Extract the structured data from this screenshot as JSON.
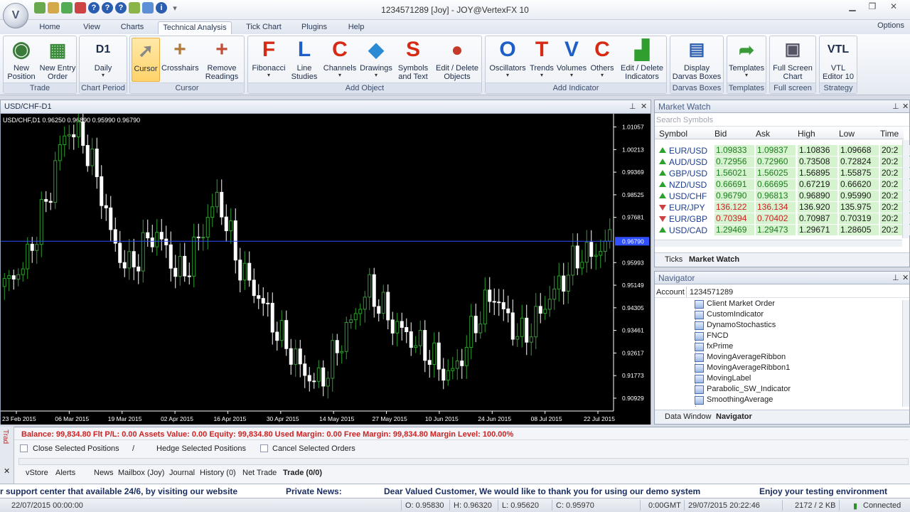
{
  "window": {
    "title": "1234571289 [Joy] - JOY@VertexFX 10",
    "logo": "V",
    "min_icon": "minimize-icon",
    "max_icon": "maximize-icon",
    "close_icon": "close-icon"
  },
  "ribbon_tabs": [
    "Home",
    "View",
    "Charts",
    "Technical Analysis",
    "Tick Chart",
    "Plugins",
    "Help"
  ],
  "options_label": "Options",
  "ribbon": {
    "trade": {
      "label": "Trade",
      "buttons": [
        "New\nPosition",
        "New Entry\nOrder"
      ]
    },
    "chart_period": {
      "label": "Chart Period",
      "buttons": [
        "Daily"
      ],
      "icon_text": "D1"
    },
    "cursor": {
      "label": "Cursor",
      "buttons": [
        "Cursor",
        "Crosshairs",
        "Remove\nReadings"
      ]
    },
    "add_object": {
      "label": "Add Object",
      "buttons": [
        "Fibonacci",
        "Line\nStudies",
        "Channels",
        "Drawings",
        "Symbols\nand Text",
        "Edit / Delete\nObjects"
      ],
      "icon_letters": [
        "F",
        "L",
        "C",
        "",
        "S",
        ""
      ]
    },
    "add_indicator": {
      "label": "Add Indicator",
      "buttons": [
        "Oscillators",
        "Trends",
        "Volumes",
        "Others",
        "Edit / Delete\nIndicators"
      ],
      "icon_letters": [
        "O",
        "T",
        "V",
        "C",
        ""
      ]
    },
    "darvas": {
      "label": "Darvas Boxes",
      "buttons": [
        "Display\nDarvas Boxes"
      ]
    },
    "templates": {
      "label": "Templates",
      "buttons": [
        "Templates"
      ]
    },
    "full_screen": {
      "label": "Full screen",
      "buttons": [
        "Full Screen\nChart"
      ]
    },
    "strategy": {
      "label": "Strategy",
      "buttons": [
        "VTL\nEditor 10"
      ],
      "icon_text": "VTL"
    }
  },
  "chart": {
    "window_title": "USD/CHF-D1",
    "ohlc_header": "USD/CHF,D1  0.96250  0.96890  0.95990  0.96790",
    "current_price_label": "0.96790",
    "price_axis": [
      "1.01057",
      "1.00213",
      "0.99369",
      "0.98525",
      "0.97681",
      "0.96790",
      "0.95993",
      "0.95149",
      "0.94305",
      "0.93461",
      "0.92617",
      "0.91773",
      "0.90929"
    ],
    "date_axis": [
      "23 Feb 2015",
      "06 Mar 2015",
      "19 Mar 2015",
      "02 Apr 2015",
      "16 Apr 2015",
      "30 Apr 2015",
      "14 May 2015",
      "27 May 2015",
      "10 Jun 2015",
      "24 Jun 2015",
      "08 Jul 2015",
      "22 Jul 2015"
    ],
    "colors": {
      "up": "#2f9e2f",
      "down": "#ffffff",
      "background": "#000000",
      "price_line": "#3050ff"
    }
  },
  "market_watch": {
    "title": "Market Watch",
    "search_placeholder": "Search Symbols",
    "columns": [
      "Symbol",
      "Bid",
      "Ask",
      "High",
      "Low",
      "Time"
    ],
    "rows": [
      {
        "dir": "up",
        "symbol": "EUR/USD",
        "bid": "1.09833",
        "ask": "1.09837",
        "high": "1.10836",
        "low": "1.09668",
        "time": "20:2"
      },
      {
        "dir": "up",
        "symbol": "AUD/USD",
        "bid": "0.72956",
        "ask": "0.72960",
        "high": "0.73508",
        "low": "0.72824",
        "time": "20:2"
      },
      {
        "dir": "up",
        "symbol": "GBP/USD",
        "bid": "1.56021",
        "ask": "1.56025",
        "high": "1.56895",
        "low": "1.55875",
        "time": "20:2"
      },
      {
        "dir": "up",
        "symbol": "NZD/USD",
        "bid": "0.66691",
        "ask": "0.66695",
        "high": "0.67219",
        "low": "0.66620",
        "time": "20:2"
      },
      {
        "dir": "up",
        "symbol": "USD/CHF",
        "bid": "0.96790",
        "ask": "0.96813",
        "high": "0.96890",
        "low": "0.95990",
        "time": "20:2"
      },
      {
        "dir": "down",
        "symbol": "EUR/JPY",
        "bid": "136.122",
        "ask": "136.134",
        "high": "136.920",
        "low": "135.975",
        "time": "20:2"
      },
      {
        "dir": "down",
        "symbol": "EUR/GBP",
        "bid": "0.70394",
        "ask": "0.70402",
        "high": "0.70987",
        "low": "0.70319",
        "time": "20:2"
      },
      {
        "dir": "up",
        "symbol": "USD/CAD",
        "bid": "1.29469",
        "ask": "1.29473",
        "high": "1.29671",
        "low": "1.28605",
        "time": "20:2"
      }
    ],
    "tabs": [
      "Ticks",
      "Market Watch"
    ]
  },
  "navigator": {
    "title": "Navigator",
    "account_label": "Account",
    "account_value": "1234571289",
    "items": [
      "Client Market Order",
      "CustomIndicator",
      "DynamoStochastics",
      "FNCD",
      "fxPrime",
      "MovingAverageRibbon",
      "MovingAverageRibbon1",
      "MovingLabel",
      "Parabolic_SW_Indicator",
      "SmoothingAverage"
    ],
    "tabs": [
      "Data Window",
      "Navigator"
    ]
  },
  "terminal": {
    "side_label": "Trad",
    "balance_line": "Balance: 99,834.80  Flt P/L: 0.00  Assets Value: 0.00  Equity: 99,834.80  Used Margin: 0.00  Free Margin: 99,834.80  Margin Level: 100.00%",
    "close_selected": "Close Selected Positions",
    "separator": "/",
    "hedge_selected": "Hedge Selected Positions",
    "cancel_selected": "Cancel Selected Orders",
    "tabs": [
      "vStore",
      "Alerts",
      "News",
      "Mailbox (Joy)",
      "Journal",
      "History (0)",
      "Net Trade",
      "Trade (0/0)"
    ]
  },
  "ticker": {
    "items": [
      "r support center that available 24/6, by visiting our website",
      "Private News:",
      "Dear Valued Customer, We would like to thank you for using our demo system",
      "Enjoy your testing environment"
    ]
  },
  "status": {
    "datetime": "22/07/2015 00:00:00",
    "open": "O: 0.95830",
    "high": "H: 0.96320",
    "low": "L: 0.95620",
    "close": "C: 0.95970",
    "gmt": "0:00GMT",
    "server_time": "29/07/2015 20:22:46",
    "traffic": "2172 / 2 KB",
    "connection": "Connected"
  }
}
